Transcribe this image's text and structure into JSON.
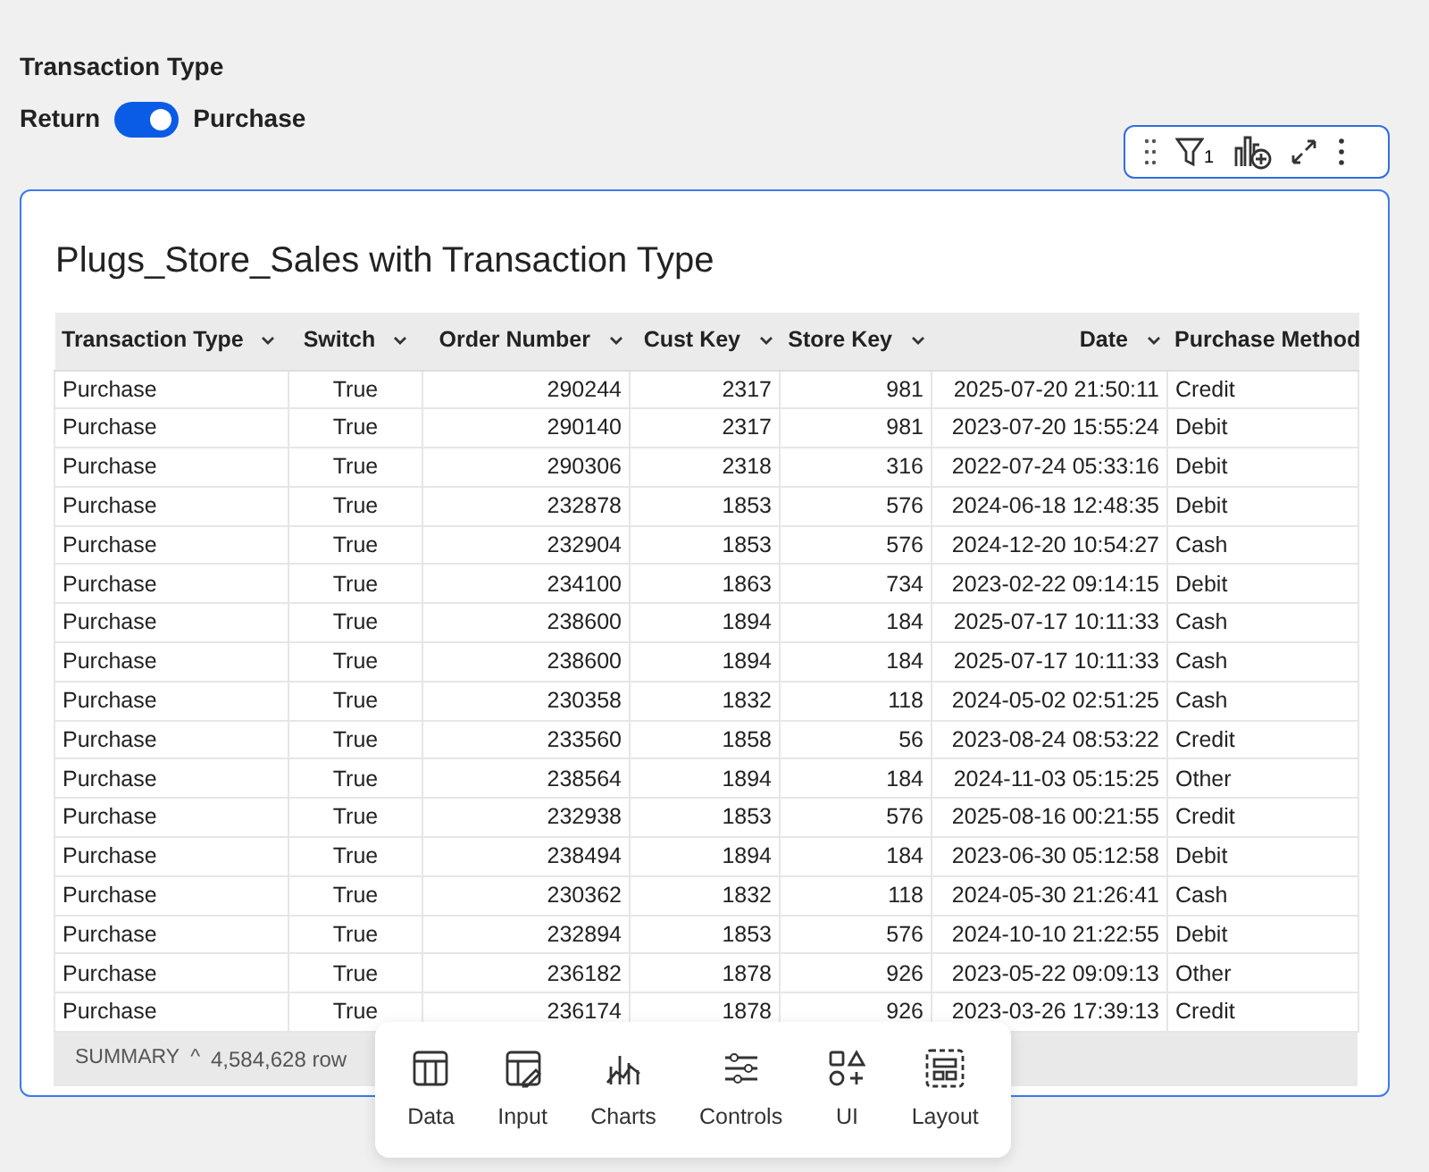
{
  "control": {
    "label": "Transaction Type",
    "off_label": "Return",
    "on_label": "Purchase",
    "on": true
  },
  "element_toolbar": {
    "filter_count": "1"
  },
  "table": {
    "title": "Plugs_Store_Sales with Transaction Type",
    "columns": [
      {
        "label": "Transaction Type",
        "kind": "text",
        "menu": true
      },
      {
        "label": "Switch",
        "kind": "flag",
        "menu": true
      },
      {
        "label": "Order Number",
        "kind": "number",
        "menu": true
      },
      {
        "label": "Cust Key",
        "kind": "number",
        "menu": true
      },
      {
        "label": "Store Key",
        "kind": "number",
        "menu": true
      },
      {
        "label": "Date",
        "kind": "date",
        "menu": true
      },
      {
        "label": "Purchase Method",
        "kind": "text"
      }
    ],
    "rows": [
      [
        "Purchase",
        "True",
        "290244",
        "2317",
        "981",
        "2025-07-20 21:50:11",
        "Credit"
      ],
      [
        "Purchase",
        "True",
        "290140",
        "2317",
        "981",
        "2023-07-20 15:55:24",
        "Debit"
      ],
      [
        "Purchase",
        "True",
        "290306",
        "2318",
        "316",
        "2022-07-24 05:33:16",
        "Debit"
      ],
      [
        "Purchase",
        "True",
        "232878",
        "1853",
        "576",
        "2024-06-18 12:48:35",
        "Debit"
      ],
      [
        "Purchase",
        "True",
        "232904",
        "1853",
        "576",
        "2024-12-20 10:54:27",
        "Cash"
      ],
      [
        "Purchase",
        "True",
        "234100",
        "1863",
        "734",
        "2023-02-22 09:14:15",
        "Debit"
      ],
      [
        "Purchase",
        "True",
        "238600",
        "1894",
        "184",
        "2025-07-17 10:11:33",
        "Cash"
      ],
      [
        "Purchase",
        "True",
        "238600",
        "1894",
        "184",
        "2025-07-17 10:11:33",
        "Cash"
      ],
      [
        "Purchase",
        "True",
        "230358",
        "1832",
        "118",
        "2024-05-02 02:51:25",
        "Cash"
      ],
      [
        "Purchase",
        "True",
        "233560",
        "1858",
        "56",
        "2023-08-24 08:53:22",
        "Credit"
      ],
      [
        "Purchase",
        "True",
        "238564",
        "1894",
        "184",
        "2024-11-03 05:15:25",
        "Other"
      ],
      [
        "Purchase",
        "True",
        "232938",
        "1853",
        "576",
        "2025-08-16 00:21:55",
        "Credit"
      ],
      [
        "Purchase",
        "True",
        "238494",
        "1894",
        "184",
        "2023-06-30 05:12:58",
        "Debit"
      ],
      [
        "Purchase",
        "True",
        "230362",
        "1832",
        "118",
        "2024-05-30 21:26:41",
        "Cash"
      ],
      [
        "Purchase",
        "True",
        "232894",
        "1853",
        "576",
        "2024-10-10 21:22:55",
        "Debit"
      ],
      [
        "Purchase",
        "True",
        "236182",
        "1878",
        "926",
        "2023-05-22 09:09:13",
        "Other"
      ],
      [
        "Purchase",
        "True",
        "236174",
        "1878",
        "926",
        "2023-03-26 17:39:13",
        "Credit"
      ]
    ],
    "summary": {
      "label": "SUMMARY",
      "caret": "^",
      "count": "4,584,628 row"
    }
  },
  "add_toolbar": [
    {
      "kind": "data",
      "label": "Data"
    },
    {
      "kind": "input",
      "label": "Input"
    },
    {
      "kind": "charts",
      "label": "Charts"
    },
    {
      "kind": "controls",
      "label": "Controls"
    },
    {
      "kind": "ui",
      "label": "UI"
    },
    {
      "kind": "layout",
      "label": "Layout"
    }
  ]
}
